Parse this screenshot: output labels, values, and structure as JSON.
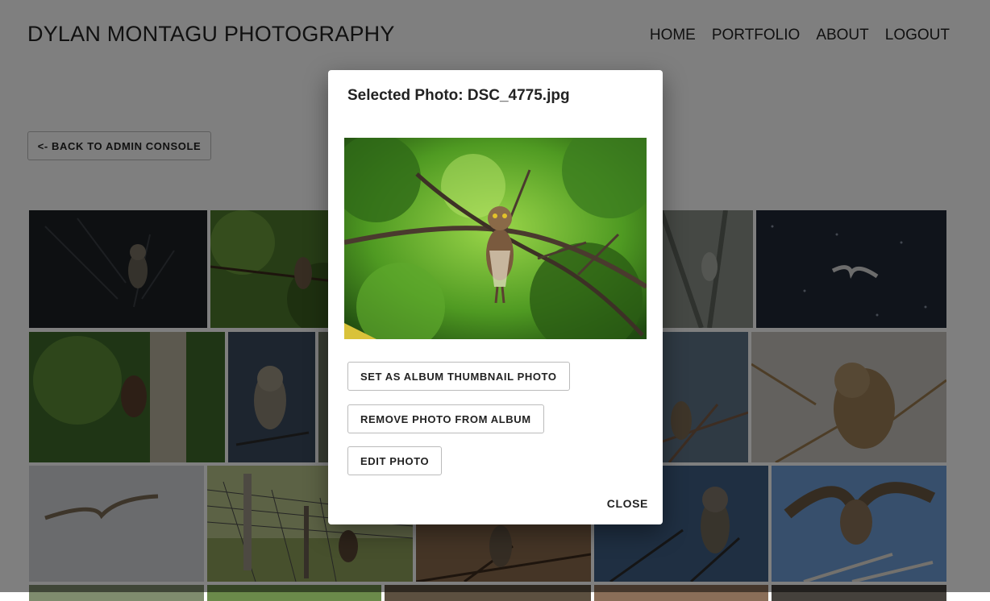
{
  "header": {
    "site_title": "DYLAN MONTAGU PHOTOGRAPHY",
    "nav": [
      {
        "label": "HOME"
      },
      {
        "label": "PORTFOLIO"
      },
      {
        "label": "ABOUT"
      },
      {
        "label": "LOGOUT"
      }
    ]
  },
  "back_button": {
    "label": "<- BACK TO ADMIN CONSOLE"
  },
  "modal": {
    "title": "Selected Photo: DSC_4775.jpg",
    "buttons": {
      "set_thumbnail": "SET AS ALBUM THUMBNAIL PHOTO",
      "remove": "REMOVE PHOTO FROM ALBUM",
      "edit": "EDIT PHOTO"
    },
    "close_label": "CLOSE"
  }
}
